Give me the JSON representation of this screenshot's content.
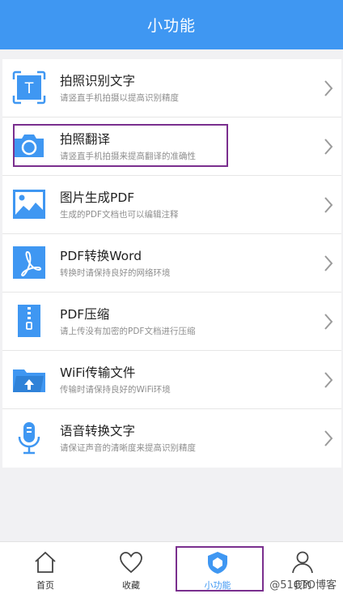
{
  "header": {
    "title": "小功能"
  },
  "features": [
    {
      "title": "拍照识别文字",
      "subtitle": "请竖直手机拍摄以提高识别精度",
      "icon": "text-scan-icon"
    },
    {
      "title": "拍照翻译",
      "subtitle": "请竖直手机拍摄来提高翻译的准确性",
      "icon": "camera-icon"
    },
    {
      "title": "图片生成PDF",
      "subtitle": "生成的PDF文档也可以编辑注释",
      "icon": "image-icon"
    },
    {
      "title": "PDF转换Word",
      "subtitle": "转换时请保持良好的网络环境",
      "icon": "pdf-icon"
    },
    {
      "title": "PDF压缩",
      "subtitle": "请上传没有加密的PDF文档进行压缩",
      "icon": "zip-icon"
    },
    {
      "title": "WiFi传输文件",
      "subtitle": "传输时请保持良好的WiFi环境",
      "icon": "folder-upload-icon"
    },
    {
      "title": "语音转换文字",
      "subtitle": "请保证声音的清晰度来提高识别精度",
      "icon": "microphone-icon"
    }
  ],
  "tabs": [
    {
      "label": "首页",
      "icon": "home-icon"
    },
    {
      "label": "收藏",
      "icon": "heart-icon"
    },
    {
      "label": "小功能",
      "icon": "shield-icon",
      "active": true
    },
    {
      "label": "我的",
      "icon": "user-icon"
    }
  ],
  "watermark": "@51CTO博客",
  "colors": {
    "primary": "#3f97f2",
    "highlight_border": "#7a2f8e"
  }
}
